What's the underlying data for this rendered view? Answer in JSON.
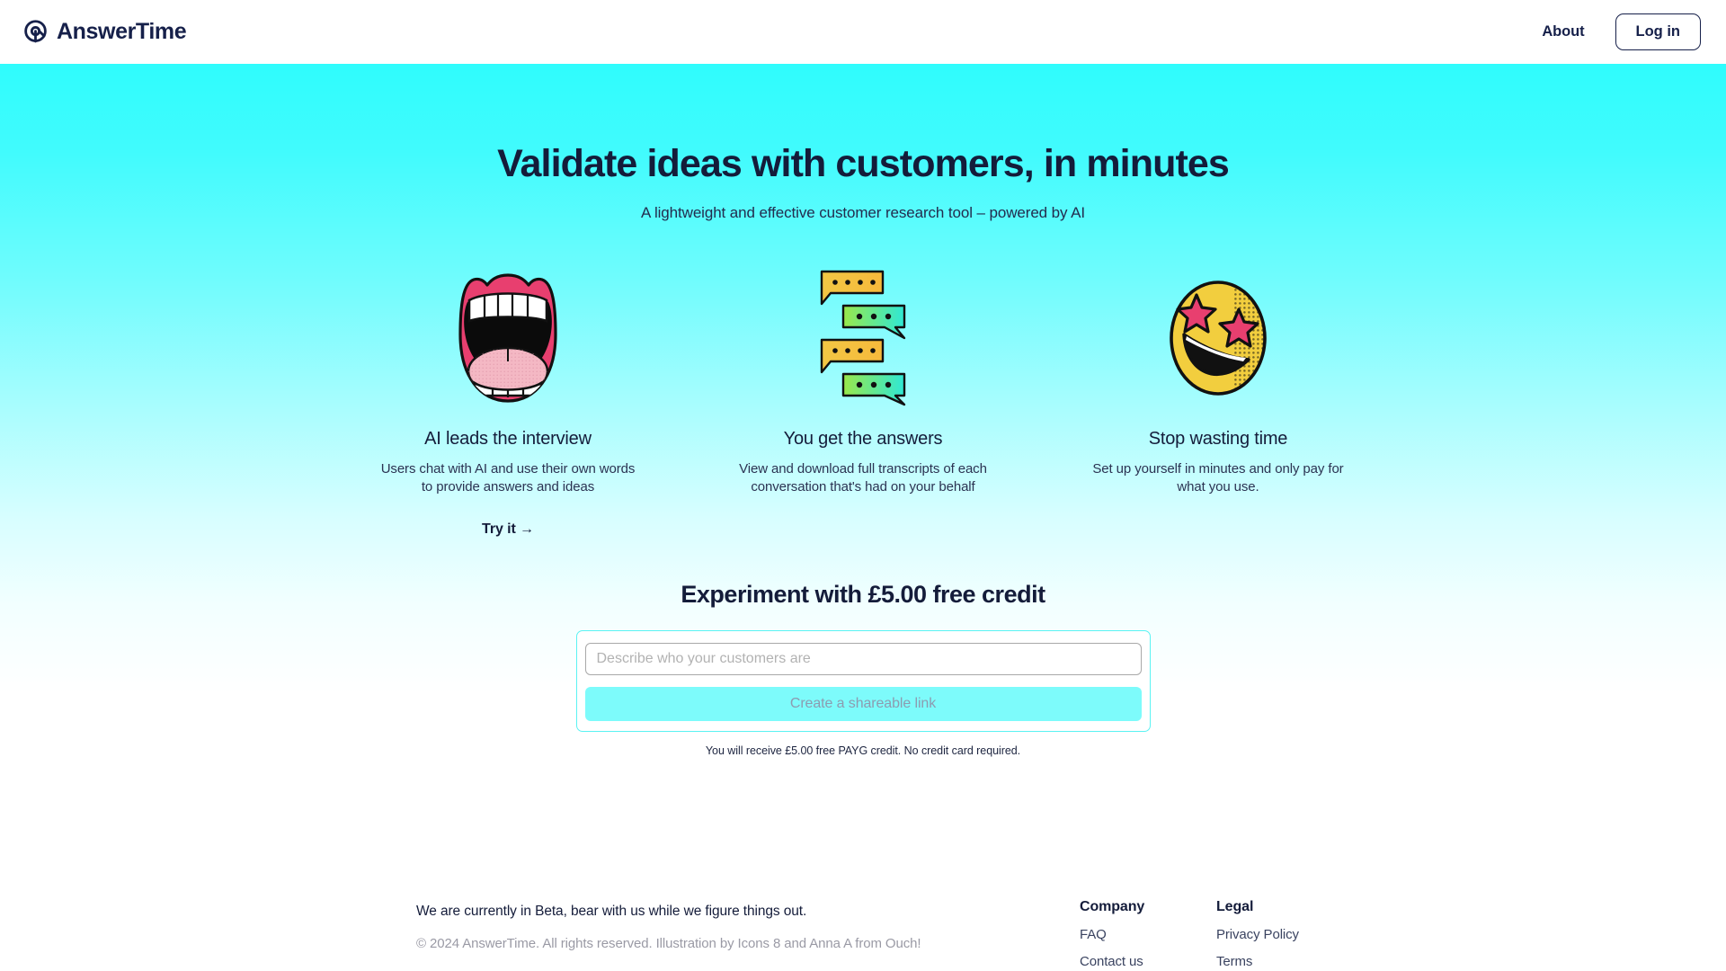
{
  "header": {
    "brand_name": "AnswerTime",
    "brand_icon": "at-circle-logo-icon",
    "about_label": "About",
    "login_label": "Log in"
  },
  "hero": {
    "title": "Validate ideas with customers, in minutes",
    "subtitle": "A lightweight and effective customer research tool – powered by AI"
  },
  "features": [
    {
      "icon": "open-mouth-illustration",
      "title": "AI leads the interview",
      "description": "Users chat with AI and use their own words to provide answers and ideas",
      "cta": "Try it →"
    },
    {
      "icon": "chat-bubbles-illustration",
      "title": "You get the answers",
      "description": "View and download full transcripts of each conversation that's had on your behalf",
      "cta": ""
    },
    {
      "icon": "star-struck-emoji-illustration",
      "title": "Stop wasting time",
      "description": "Set up yourself in minutes and only pay for what you use.",
      "cta": ""
    }
  ],
  "signup": {
    "title": "Experiment with £5.00 free credit",
    "input_placeholder": "Describe who your customers are",
    "input_value": "",
    "submit_label": "Create a shareable link",
    "note": "You will receive £5.00 free PAYG credit. No credit card required."
  },
  "footer": {
    "beta_notice": "We are currently in Beta, bear with us while we figure things out.",
    "copyright": "© 2024 AnswerTime. All rights reserved. Illustration by Icons 8 and Anna A from Ouch!",
    "columns": [
      {
        "title": "Company",
        "links": [
          "FAQ",
          "Contact us"
        ]
      },
      {
        "title": "Legal",
        "links": [
          "Privacy Policy",
          "Terms"
        ]
      }
    ]
  },
  "colors": {
    "accent_cyan": "#2ffcfd",
    "button_cyan": "#7dfbfb",
    "ink": "#141c3a",
    "muted": "#9a9aa5"
  }
}
